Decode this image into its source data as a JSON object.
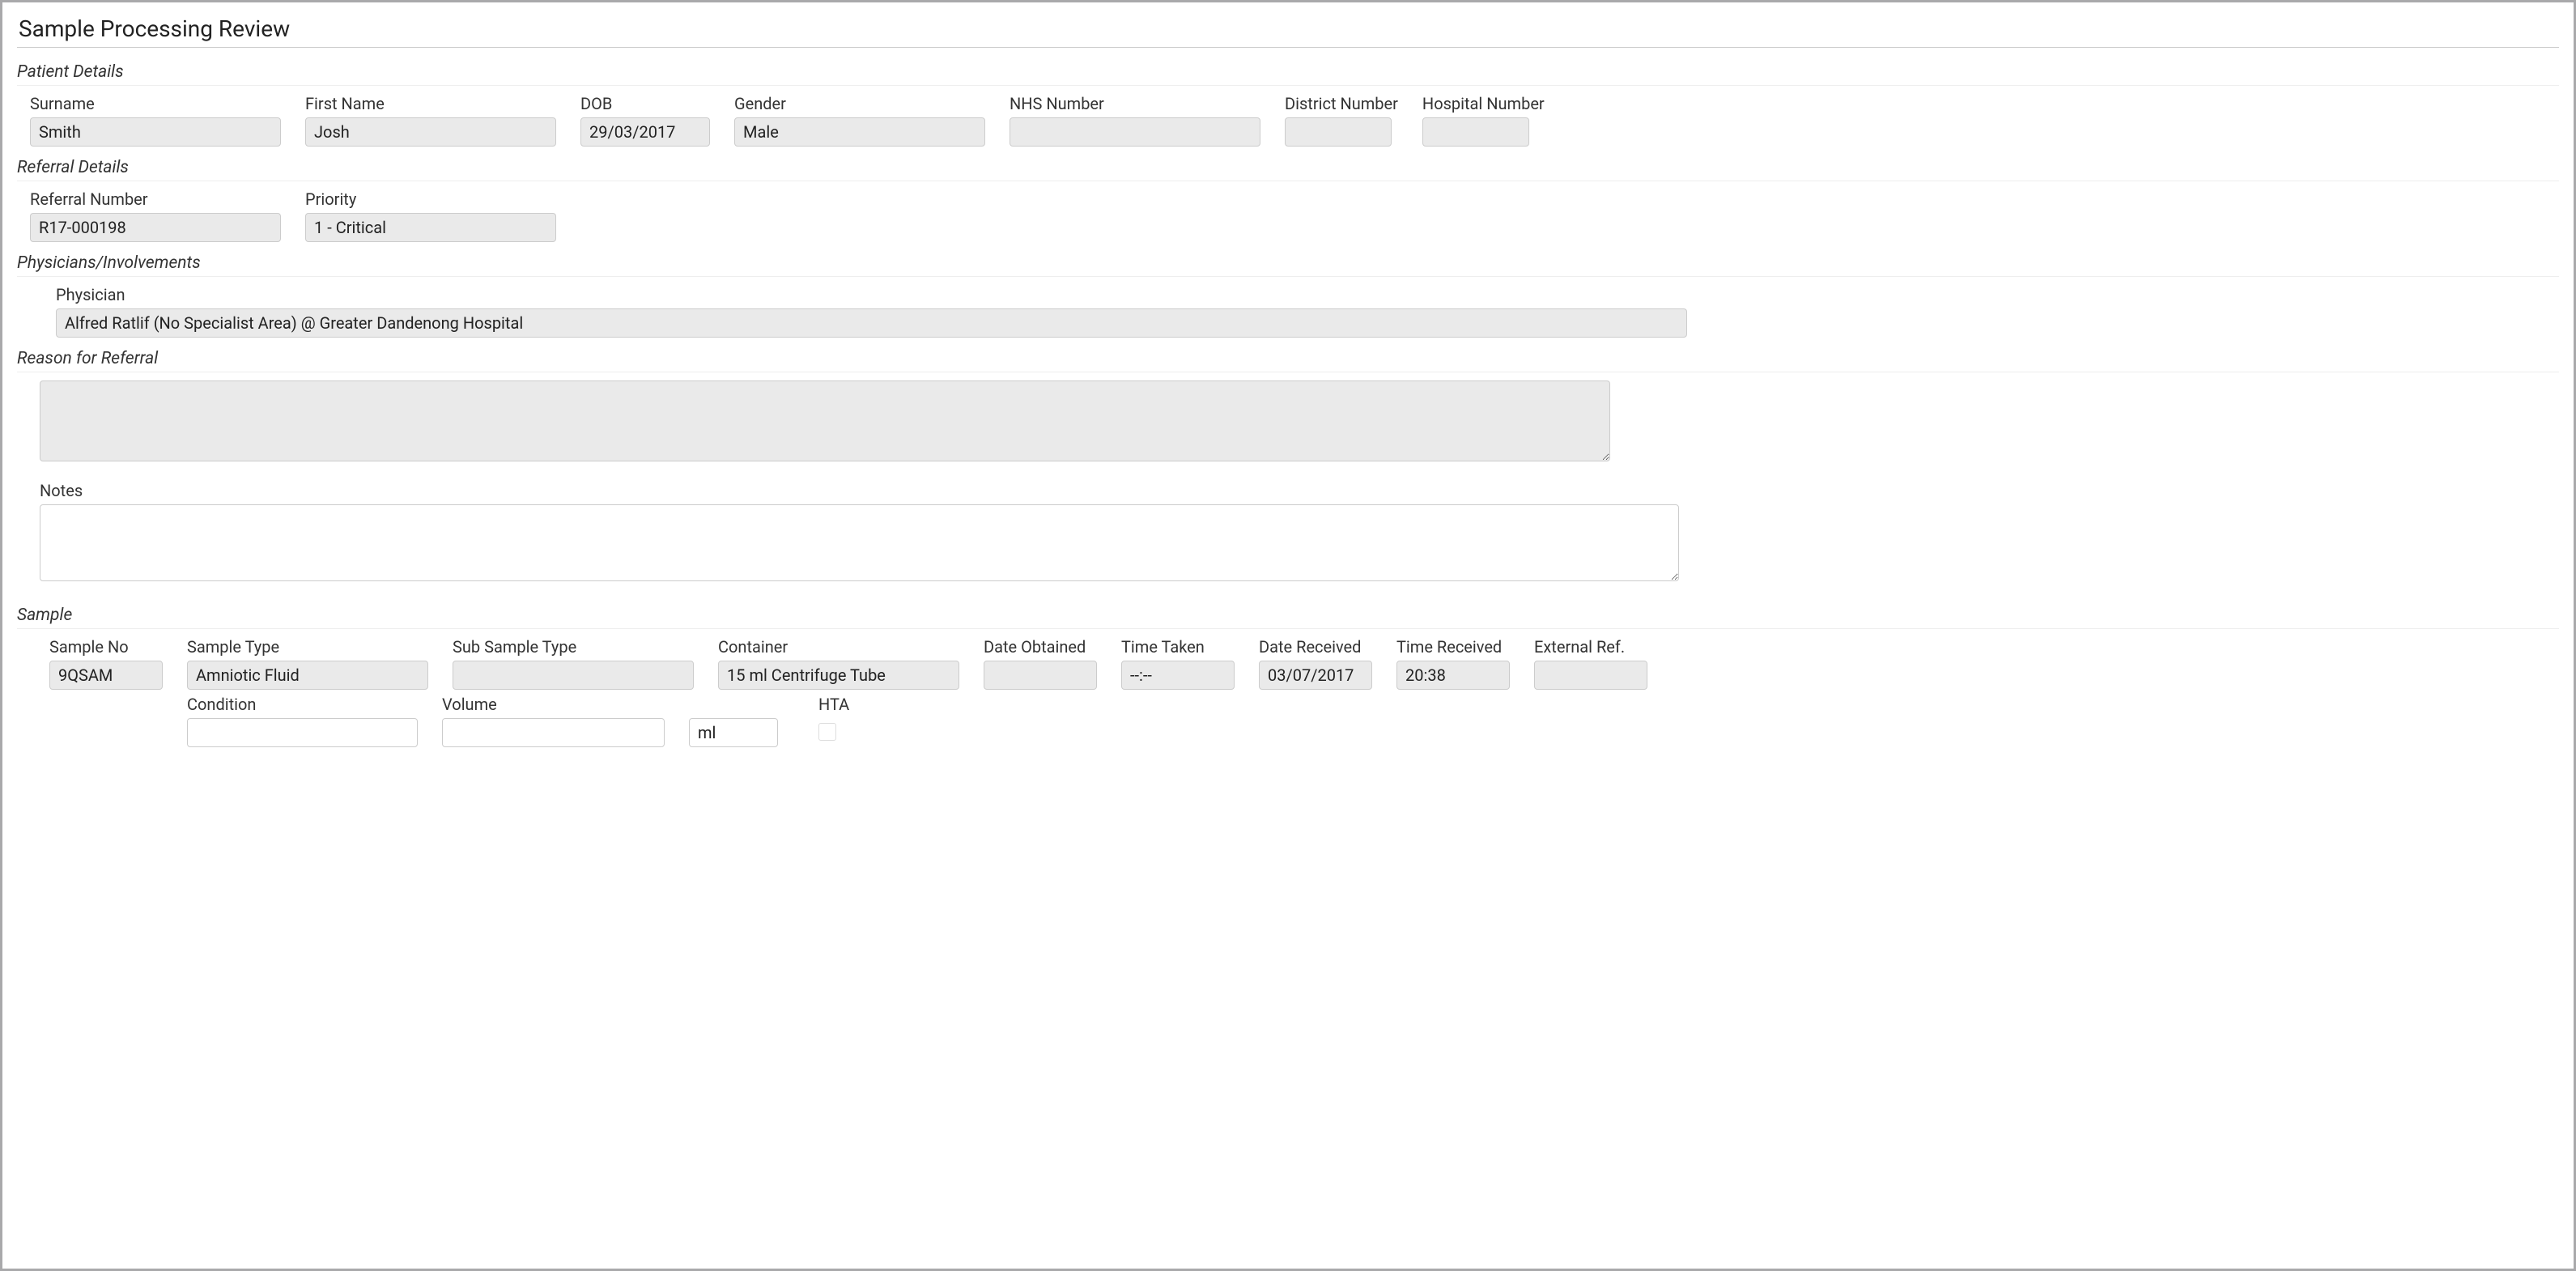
{
  "page": {
    "title": "Sample Processing Review"
  },
  "sections": {
    "patient": "Patient Details",
    "referral": "Referral Details",
    "physicians": "Physicians/Involvements",
    "reason": "Reason for Referral",
    "sample": "Sample"
  },
  "patient": {
    "surname_label": "Surname",
    "surname": "Smith",
    "firstname_label": "First Name",
    "firstname": "Josh",
    "dob_label": "DOB",
    "dob": "29/03/2017",
    "gender_label": "Gender",
    "gender": "Male",
    "nhs_label": "NHS Number",
    "nhs": "",
    "district_label": "District Number",
    "district": "",
    "hospital_label": "Hospital Number",
    "hospital": ""
  },
  "referral": {
    "refnum_label": "Referral Number",
    "refnum": "R17-000198",
    "priority_label": "Priority",
    "priority": "1 - Critical"
  },
  "physicians": {
    "label": "Physician",
    "value": "Alfred Ratlif (No Specialist Area) @ Greater Dandenong Hospital"
  },
  "reason": {
    "value": "",
    "notes_label": "Notes",
    "notes": ""
  },
  "sample": {
    "sampleno_label": "Sample No",
    "sampleno": "9QSAM",
    "sampletype_label": "Sample Type",
    "sampletype": "Amniotic Fluid",
    "subsampletype_label": "Sub Sample Type",
    "subsampletype": "",
    "container_label": "Container",
    "container": "15 ml Centrifuge Tube",
    "dateobtained_label": "Date Obtained",
    "dateobtained": "",
    "timetaken_label": "Time Taken",
    "timetaken": "--:--",
    "datereceived_label": "Date Received",
    "datereceived": "03/07/2017",
    "timereceived_label": "Time Received",
    "timereceived": "20:38",
    "externalref_label": "External Ref.",
    "externalref": "",
    "condition_label": "Condition",
    "condition": "",
    "volume_label": "Volume",
    "volume": "",
    "volume_unit": "ml",
    "hta_label": "HTA",
    "hta_checked": false
  }
}
